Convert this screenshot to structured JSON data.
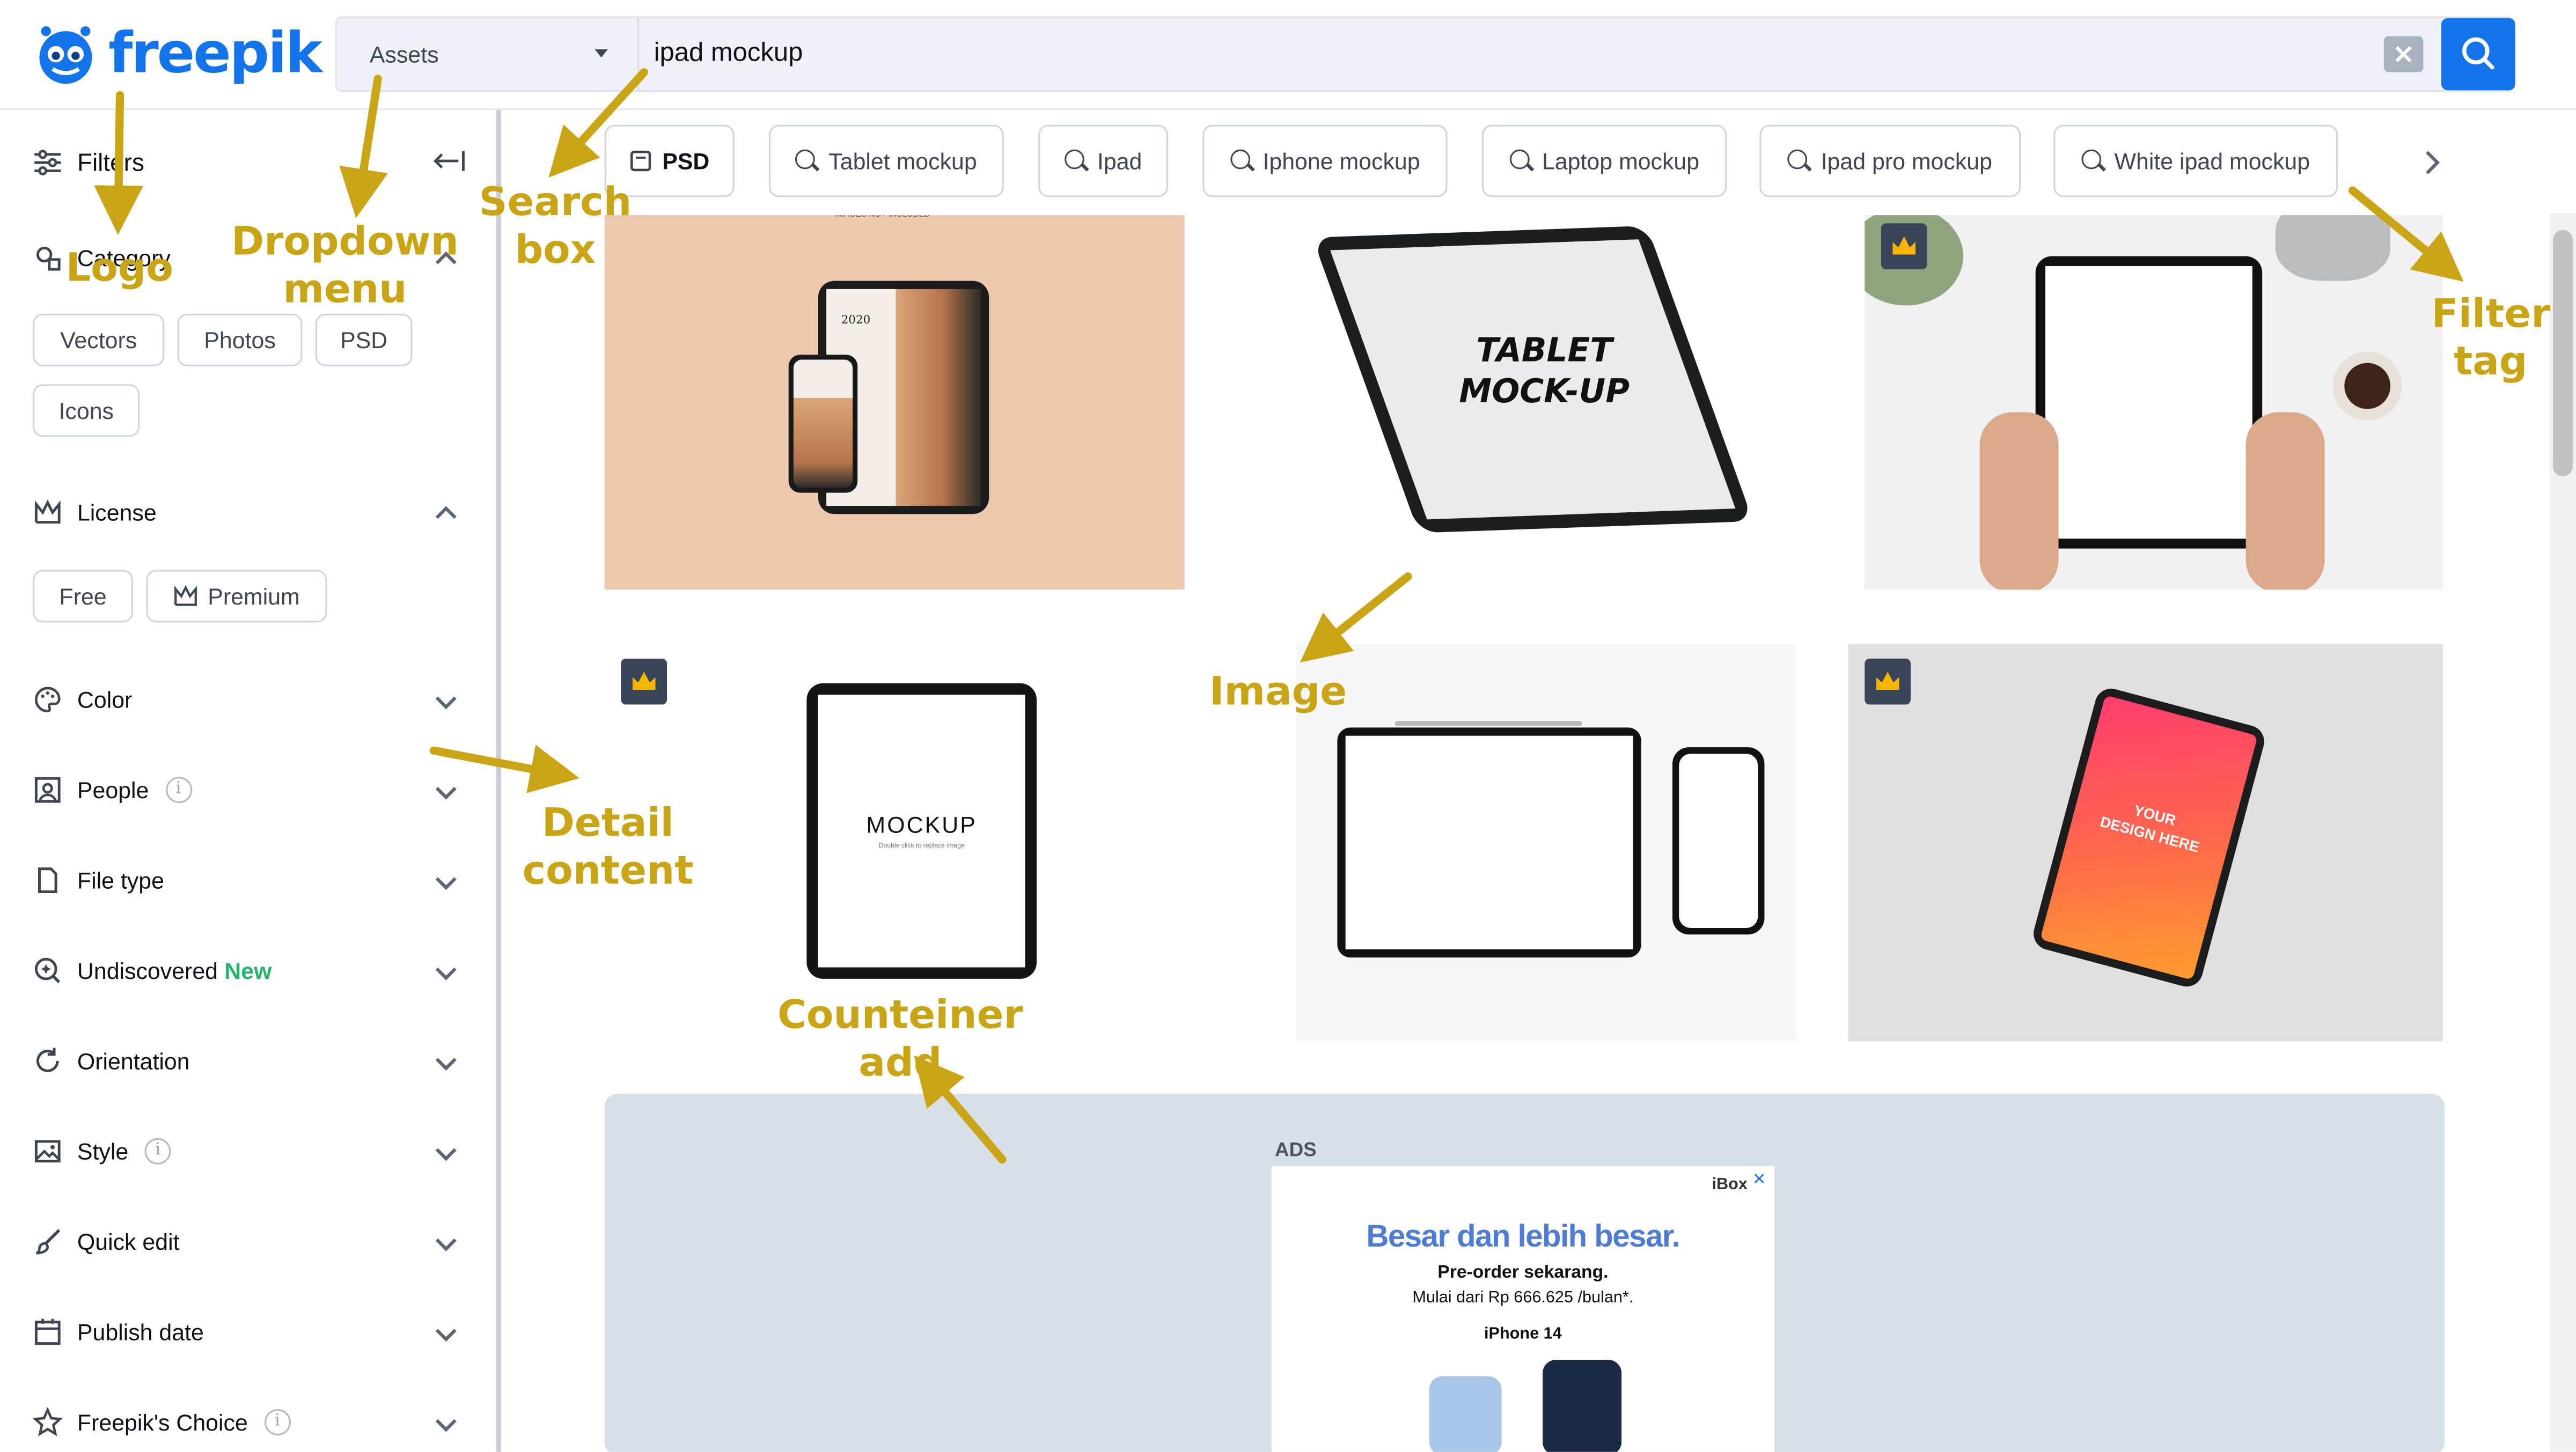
{
  "header": {
    "logo_text": "freepik",
    "asset_dropdown": "Assets",
    "search_value": "ipad mockup"
  },
  "sidebar": {
    "title": "Filters",
    "category": {
      "label": "Category",
      "chips": [
        "Vectors",
        "Photos",
        "PSD",
        "Icons"
      ]
    },
    "license": {
      "label": "License",
      "chips": [
        "Free",
        "Premium"
      ]
    },
    "sections": [
      {
        "label": "Color",
        "icon": "palette-icon"
      },
      {
        "label": "People",
        "icon": "portrait-icon",
        "info": "i"
      },
      {
        "label": "File type",
        "icon": "file-icon"
      },
      {
        "label": "Undiscovered",
        "icon": "discover-icon",
        "badge": "New"
      },
      {
        "label": "Orientation",
        "icon": "rotate-icon"
      },
      {
        "label": "Style",
        "icon": "image-style-icon",
        "info": "i"
      },
      {
        "label": "Quick edit",
        "icon": "brush-icon"
      },
      {
        "label": "Publish date",
        "icon": "calendar-icon"
      },
      {
        "label": "Freepik's Choice",
        "icon": "star-icon",
        "info": "i"
      }
    ]
  },
  "filter_tags": [
    "PSD",
    "Tablet mockup",
    "Ipad",
    "Iphone mockup",
    "Laptop mockup",
    "Ipad pro mockup",
    "White ipad mockup"
  ],
  "images": {
    "img1_tiny": "IMAGES NOT INCLUDED",
    "img1_year": "2020",
    "img2_text_1": "TABLET",
    "img2_text_2": "MOCK-UP",
    "img4_text": "MOCKUP",
    "img4_subtext": "Double click to replace image",
    "img6_text_1": "YOUR",
    "img6_text_2": "DESIGN HERE"
  },
  "ads": {
    "label": "ADS",
    "headline": "Besar dan lebih besar.",
    "line1": "Pre-order sekarang.",
    "line2": "Mulai dari Rp 666.625 /bulan*.",
    "line3": "iPhone 14",
    "brand": "iBox",
    "close": "×"
  },
  "annotations": {
    "logo": "Logo",
    "dropdown": [
      "Dropdown",
      "menu"
    ],
    "search_box": "Search box",
    "filter_tag": [
      "Filter",
      "tag"
    ],
    "image": "Image",
    "detail_content": [
      "Detail",
      "content"
    ],
    "container_add": "Counteiner add"
  },
  "colors": {
    "brand_blue": "#1273eb",
    "annotation": "#c9a515",
    "premium_badge": "#3a4657",
    "new_badge": "#27b36a",
    "ads_bg": "#d6e1e7"
  }
}
